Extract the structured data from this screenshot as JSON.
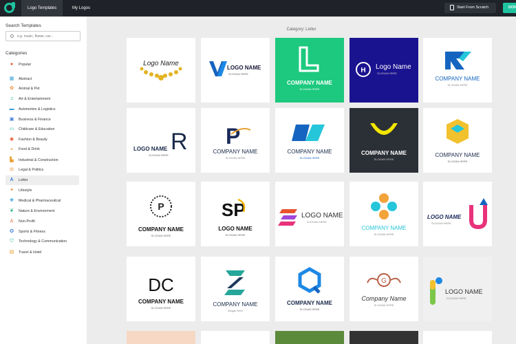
{
  "topbar": {
    "tab_templates": "Logo Templates",
    "tab_my_logos": "My Logos",
    "start_scratch": "Start From Scratch",
    "green_button": "DON"
  },
  "sidebar": {
    "search_heading": "Search Templates",
    "search_placeholder": "e.g. music, flower, car...",
    "categories_heading": "Categories",
    "categories": [
      {
        "label": "Popular",
        "icon": "flame-icon",
        "color": "#e8532f"
      },
      {
        "label": "Abstract",
        "icon": "abstract-icon",
        "color": "#3aa3d9"
      },
      {
        "label": "Animal & Pet",
        "icon": "paw-icon",
        "color": "#e88a2f"
      },
      {
        "label": "Art & Entertainment",
        "icon": "music-icon",
        "color": "#1fb37d"
      },
      {
        "label": "Automotive & Logistics",
        "icon": "car-icon",
        "color": "#3aa3d9"
      },
      {
        "label": "Business & Finance",
        "icon": "briefcase-icon",
        "color": "#3a7bd9"
      },
      {
        "label": "Childcare & Education",
        "icon": "education-icon",
        "color": "#1fb3a0"
      },
      {
        "label": "Fashion & Beauty",
        "icon": "lips-icon",
        "color": "#e8532f"
      },
      {
        "label": "Food & Drink",
        "icon": "food-icon",
        "color": "#e88a2f"
      },
      {
        "label": "Industrial & Construction",
        "icon": "factory-icon",
        "color": "#e8a02f"
      },
      {
        "label": "Legal & Politics",
        "icon": "scales-icon",
        "color": "#e88a2f"
      },
      {
        "label": "Letter",
        "icon": "letter-a-icon",
        "color": "#3a7bd9"
      },
      {
        "label": "Lifestyle",
        "icon": "lifestyle-icon",
        "color": "#e88a2f"
      },
      {
        "label": "Medical & Pharmaceutical",
        "icon": "medical-icon",
        "color": "#3aa3d9"
      },
      {
        "label": "Nature & Environment",
        "icon": "leaf-icon",
        "color": "#1fb37d"
      },
      {
        "label": "Non-Profit",
        "icon": "person-icon",
        "color": "#e8532f"
      },
      {
        "label": "Sports & Fitness",
        "icon": "sports-icon",
        "color": "#3a7bd9"
      },
      {
        "label": "Technology & Communication",
        "icon": "shield-icon",
        "color": "#1fb3a0"
      },
      {
        "label": "Travel & Hotel",
        "icon": "travel-icon",
        "color": "#e8a02f"
      }
    ]
  },
  "main": {
    "category_title": "Category: Letter",
    "logos": {
      "r1c1": {
        "title": "Logo Name"
      },
      "r1c2": {
        "title": "LOGO NAME",
        "slogan": "SLOGAN HERE"
      },
      "r1c3": {
        "title": "COMPANY NAME",
        "slogan": "SLOGAN HERE",
        "bg": "#1dc97e"
      },
      "r1c4": {
        "title": "Logo Name",
        "slogan": "SLOGAN HERE",
        "bg": "#1a1390"
      },
      "r1c5": {
        "title": "COMPANY NAME",
        "slogan": "SLOGAN HERE"
      },
      "r2c1": {
        "title": "LOGO NAME",
        "slogan": "SLOGAN HERE"
      },
      "r2c2": {
        "title": "COMPANY NAME",
        "slogan": "SLOGAN HERE"
      },
      "r2c3": {
        "title": "COMPANY NAME",
        "slogan": "SLOGAN HERE"
      },
      "r2c4": {
        "title": "COMPANY NAME",
        "slogan": "SLOGAN HERE",
        "bg": "#2b2f36"
      },
      "r2c5": {
        "title": "COMPANY NAME",
        "slogan": "SLOGAN HERE"
      },
      "r3c1": {
        "title": "COMPANY NAME",
        "slogan": "SLOGAN HERE"
      },
      "r3c2": {
        "title": "LOGO NAME",
        "slogan": "SLOGAN HERE"
      },
      "r3c3": {
        "title": "LOGO NAME",
        "slogan": "SLOGAN HERE"
      },
      "r3c4": {
        "title": "COMPANY NAME",
        "slogan": "SLOGAN HERE"
      },
      "r3c5": {
        "title": "LOGO NAME",
        "slogan": "SLOGAN HERE"
      },
      "r4c1": {
        "title": "COMPANY NAME",
        "slogan": "SLOGAN HERE"
      },
      "r4c2": {
        "title": "COMPANY NAME",
        "slogan": "Slogan Here"
      },
      "r4c3": {
        "title": "COMPANY NAME",
        "slogan": "SLOGAN HERE"
      },
      "r4c4": {
        "title": "Company Name",
        "slogan": "SLOGAN HERE"
      },
      "r4c5": {
        "title": "LOGO NAME",
        "slogan": "SLOGAN HERE",
        "bg": "#f0f0f0"
      }
    }
  }
}
